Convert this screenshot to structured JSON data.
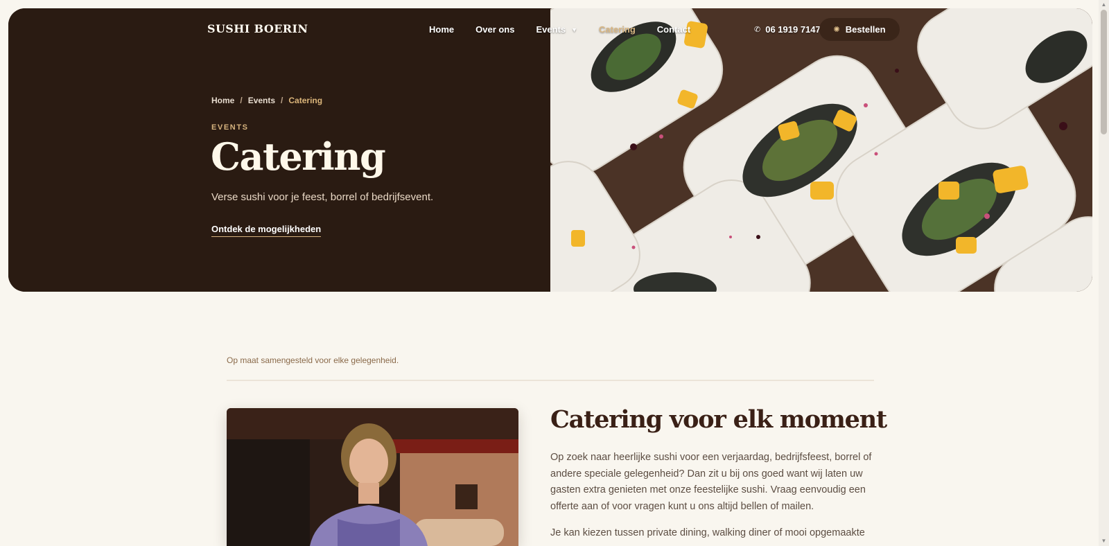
{
  "header": {
    "logo": "SUSHI BOERIN",
    "nav": [
      {
        "label": "Home",
        "active": false
      },
      {
        "label": "Over ons",
        "active": false
      },
      {
        "label": "Events",
        "active": false,
        "has_dropdown": true
      },
      {
        "label": "Catering",
        "active": true
      },
      {
        "label": "Contact",
        "active": false
      }
    ],
    "dropdown_icon": "caret-down-icon",
    "phone_icon": "phone-icon",
    "phone": "06 1919 7147",
    "order_button_icon": "sun-icon",
    "order_button": "Bestellen"
  },
  "hero": {
    "breadcrumb": [
      "Home",
      "Events",
      "Catering"
    ],
    "breadcrumb_separator": "/",
    "eyebrow": "EVENTS",
    "title": "Catering",
    "subtitle": "Verse sushi voor je feest, borrel of bedrijfsevent.",
    "cta": "Ontdek de mogelijkheden"
  },
  "main": {
    "intro_note": "Op maat samengesteld voor elke gelegenheid.",
    "section_title": "Catering voor elk moment",
    "paragraph_1": "Op zoek naar heerlijke sushi voor een verjaardag, bedrijfsfeest, borrel of andere speciale gelegenheid? Dan zit u bij ons goed want wij laten uw gasten extra genieten met onze feestelijke sushi. Vraag eenvoudig een offerte aan of voor vragen kunt u ons altijd bellen of mailen.",
    "paragraph_2": "Je kan kiezen tussen private dining, walking diner of mooi opgemaakte"
  },
  "colors": {
    "hero_background": "#2a1b12",
    "accent": "#d6b37e",
    "page_background": "#f9f6ef",
    "heading": "#3a2016"
  }
}
